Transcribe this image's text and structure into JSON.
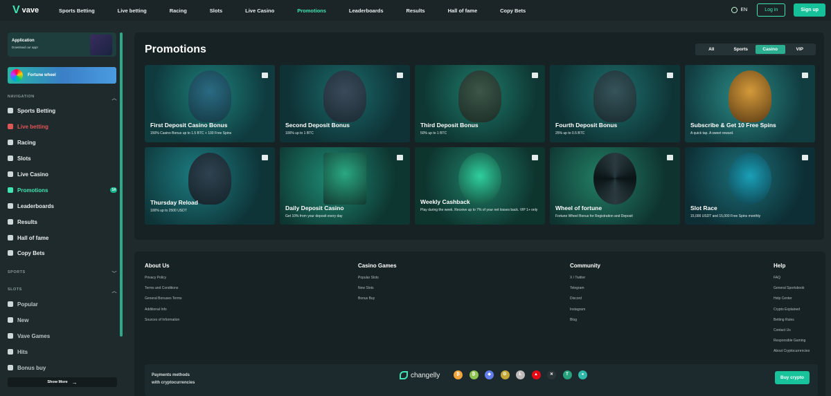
{
  "header": {
    "brand": "vave",
    "nav": [
      "Sports Betting",
      "Live betting",
      "Racing",
      "Slots",
      "Live Casino",
      "Promotions",
      "Leaderboards",
      "Results",
      "Hall of fame",
      "Copy Bets"
    ],
    "active_nav": "Promotions",
    "language": "EN",
    "login_label": "Log in",
    "signup_label": "Sign up"
  },
  "sidebar": {
    "app_title": "Application",
    "app_subtitle": "Download our app!",
    "fortune_label": "Fortune wheel",
    "navigation_header": "NAVIGATION",
    "items": [
      {
        "label": "Sports Betting",
        "icon": "ball-icon"
      },
      {
        "label": "Live betting",
        "icon": "live-icon"
      },
      {
        "label": "Racing",
        "icon": "horse-icon"
      },
      {
        "label": "Slots",
        "icon": "slot-icon"
      },
      {
        "label": "Live Casino",
        "icon": "dealer-icon"
      },
      {
        "label": "Promotions",
        "icon": "promo-icon",
        "badge": "14"
      },
      {
        "label": "Leaderboards",
        "icon": "leaderboard-icon"
      },
      {
        "label": "Results",
        "icon": "flag-icon"
      },
      {
        "label": "Hall of fame",
        "icon": "trophy-icon"
      },
      {
        "label": "Copy Bets",
        "icon": "copy-icon"
      }
    ],
    "sports_header": "SPORTS",
    "slots_header": "SLOTS",
    "slot_items": [
      {
        "label": "Popular",
        "icon": "popular-icon"
      },
      {
        "label": "New",
        "icon": "star-icon"
      },
      {
        "label": "Vave Games",
        "icon": "vave-icon"
      },
      {
        "label": "Hits",
        "icon": "hits-icon"
      },
      {
        "label": "Bonus buy",
        "icon": "bonus-icon"
      }
    ],
    "show_more_label": "Show More"
  },
  "main": {
    "title": "Promotions",
    "filters": [
      "All",
      "Sports",
      "Casino",
      "VIP"
    ],
    "active_filter": "Casino",
    "cards": [
      {
        "title": "First Deposit Casino Bonus",
        "subtitle": "150% Casino Bonus up to 1.5 BTC + 100 Free Spins"
      },
      {
        "title": "Second Deposit Bonus",
        "subtitle": "100% up to 1 BTC"
      },
      {
        "title": "Third Deposit Bonus",
        "subtitle": "50% up to 1 BTC"
      },
      {
        "title": "Fourth Deposit Bonus",
        "subtitle": "25% up to 0.5 BTC"
      },
      {
        "title": "Subscribe & Get 10 Free Spins",
        "subtitle": "A quick tap. A sweet reward."
      },
      {
        "title": "Thursday Reload",
        "subtitle": "100% up to 2500 USDT"
      },
      {
        "title": "Daily Deposit Casino",
        "subtitle": "Get 10% from your deposit every day"
      },
      {
        "title": "Weekly Cashback",
        "subtitle": "Play during the week. Receive up to 7% of your net losses back. VIP 1+ only"
      },
      {
        "title": "Wheel of fortune",
        "subtitle": "Fortune Wheel Bonus for Registration and Deposit"
      },
      {
        "title": "Slot Race",
        "subtitle": "15,000 USDT and 15,000 Free Spins monthly"
      }
    ]
  },
  "footer": {
    "about": {
      "title": "About Us",
      "links": [
        "Privacy Policy",
        "Terms and Conditions",
        "General Bonuses Terms",
        "Additional Info",
        "Sources of Information"
      ]
    },
    "casino": {
      "title": "Casino Games",
      "links": [
        "Popular Slots",
        "New Slots",
        "Bonus Buy"
      ]
    },
    "community": {
      "title": "Community",
      "links": [
        "X / Twitter",
        "Telegram",
        "Discord",
        "Instagram",
        "Blog"
      ]
    },
    "help": {
      "title": "Help",
      "links": [
        "FAQ",
        "General Sportsbook",
        "Help Center",
        "Crypto Explained",
        "Betting Rules",
        "Contact Us",
        "Responsible Gaming",
        "About Cryptocurrencies"
      ]
    },
    "payments_line1": "Payments methods",
    "payments_line2": "with cryptocurrencies",
    "changelly": "changelly",
    "buy_crypto_label": "Buy crypto"
  }
}
